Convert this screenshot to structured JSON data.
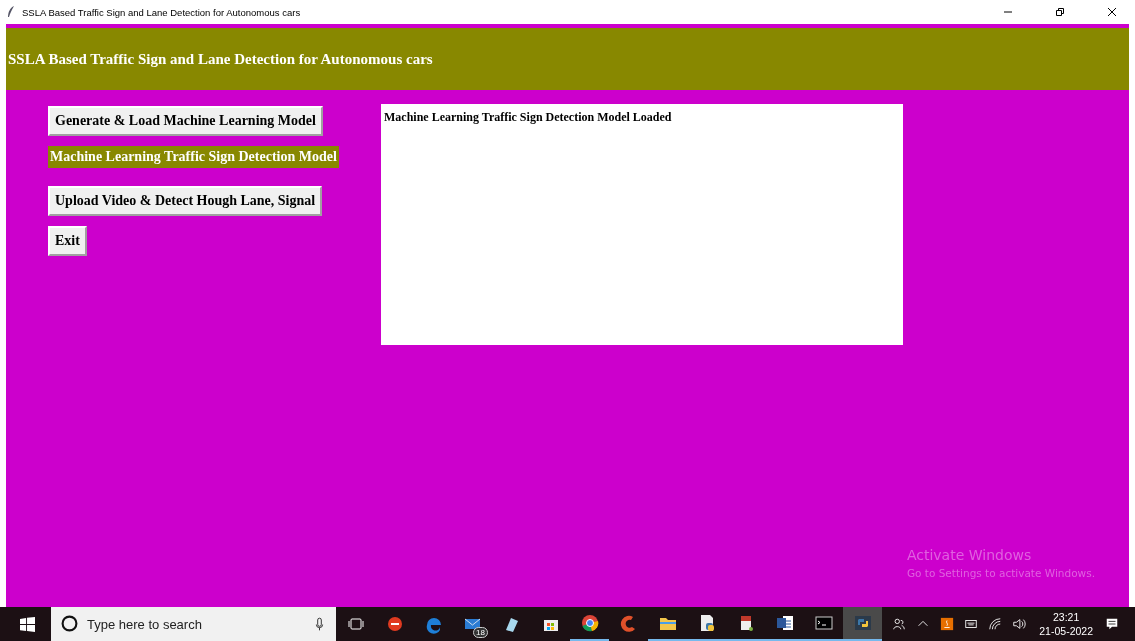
{
  "window": {
    "title": "SSLA Based Traffic Sign and Lane Detection for Autonomous cars"
  },
  "header": {
    "title": "SSLA Based Traffic Sign and Lane Detection for Autonomous cars"
  },
  "controls": [
    {
      "kind": "button",
      "label": "Generate & Load Machine Learning Model"
    },
    {
      "kind": "label",
      "label": "Machine Learning Traffic Sign Detection Model"
    },
    {
      "kind": "button",
      "label": "Upload Video & Detect Hough Lane, Signal"
    },
    {
      "kind": "button",
      "label": "Exit"
    }
  ],
  "output": {
    "text": "Machine Learning Traffic Sign Detection Model Loaded"
  },
  "activation": {
    "title": "Activate Windows",
    "subtitle": "Go to Settings to activate Windows."
  },
  "taskbar": {
    "search_placeholder": "Type here to search",
    "apps": [
      {
        "kind": "taskview",
        "running": false,
        "selected": false
      },
      {
        "kind": "flame",
        "running": false,
        "selected": false
      },
      {
        "kind": "edge",
        "running": false,
        "selected": false
      },
      {
        "kind": "mail",
        "running": false,
        "selected": false,
        "badge": "18"
      },
      {
        "kind": "notes",
        "running": false,
        "selected": false
      },
      {
        "kind": "store",
        "running": false,
        "selected": false
      },
      {
        "kind": "chrome",
        "running": true,
        "selected": false
      },
      {
        "kind": "brush",
        "running": false,
        "selected": false
      },
      {
        "kind": "folder",
        "running": true,
        "selected": false
      },
      {
        "kind": "pyfile",
        "running": true,
        "selected": false
      },
      {
        "kind": "doc",
        "running": true,
        "selected": false
      },
      {
        "kind": "word",
        "running": true,
        "selected": false
      },
      {
        "kind": "terminal",
        "running": true,
        "selected": false
      },
      {
        "kind": "python",
        "running": true,
        "selected": true
      }
    ],
    "time": "23:21",
    "date": "21-05-2022"
  }
}
